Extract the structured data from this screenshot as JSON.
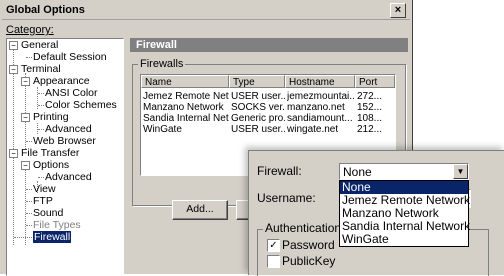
{
  "window": {
    "title": "Global Options",
    "close_glyph": "×"
  },
  "category_label": "Category:",
  "tree": {
    "general": "General",
    "default_session": "Default Session",
    "terminal": "Terminal",
    "appearance": "Appearance",
    "ansi_color": "ANSI Color",
    "color_schemes": "Color Schemes",
    "printing": "Printing",
    "advanced_printing": "Advanced",
    "web_browser": "Web Browser",
    "file_transfer": "File Transfer",
    "options": "Options",
    "advanced_options": "Advanced",
    "view": "View",
    "ftp": "FTP",
    "sound": "Sound",
    "file_types": "File Types",
    "firewall": "Firewall",
    "expand_minus": "−"
  },
  "panel": {
    "header": "Firewall",
    "group": "Firewalls"
  },
  "table": {
    "columns": [
      "Name",
      "Type",
      "Hostname",
      "Port"
    ],
    "rows": [
      [
        "Jemez Remote Netw...",
        "USER user...",
        "jemezmountai...",
        "272..."
      ],
      [
        "Manzano Network",
        "SOCKS ver...",
        "manzano.net",
        "152..."
      ],
      [
        "Sandia Internal Net...",
        "Generic pro...",
        "sandiamount...",
        "108..."
      ],
      [
        "WinGate",
        "USER user...",
        "wingate.net",
        "212..."
      ]
    ]
  },
  "buttons": {
    "add": "Add..."
  },
  "popup": {
    "firewall_label": "Firewall:",
    "firewall_value": "None",
    "username_label": "Username:",
    "auth_label": "Authentication",
    "password_label": "Password",
    "publickey_label": "PublicKey",
    "check_glyph": "✓",
    "arrow_glyph": "▼",
    "options": [
      "None",
      "Jemez Remote Network",
      "Manzano Network",
      "Sandia Internal Network",
      "WinGate"
    ]
  }
}
